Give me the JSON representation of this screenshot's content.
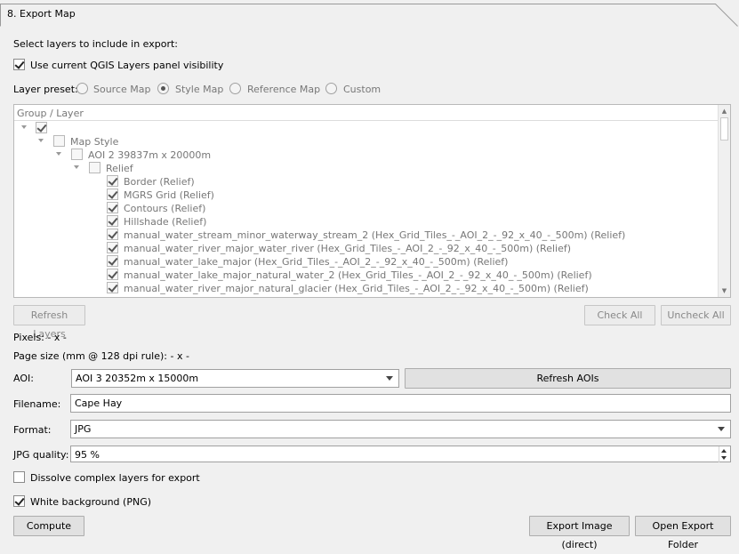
{
  "section": {
    "title": "8. Export Map"
  },
  "select_layers_label": "Select layers to include in export:",
  "use_visibility": {
    "label": "Use current QGIS Layers panel visibility",
    "checked": true
  },
  "layer_preset": {
    "label": "Layer preset:",
    "options": [
      {
        "label": "Source Map",
        "selected": false
      },
      {
        "label": "Style Map",
        "selected": true
      },
      {
        "label": "Reference Map",
        "selected": false
      },
      {
        "label": "Custom",
        "selected": false
      }
    ]
  },
  "tree": {
    "header": "Group / Layer",
    "group": "Map Style",
    "aoi": "AOI 2 39837m x 20000m",
    "subgroup": "Relief",
    "layers": [
      "Border (Relief)",
      "MGRS Grid (Relief)",
      "Contours (Relief)",
      "Hillshade (Relief)",
      "manual_water_stream_minor_waterway_stream_2 (Hex_Grid_Tiles_-_AOI_2_-_92_x_40_-_500m) (Relief)",
      "manual_water_river_major_water_river (Hex_Grid_Tiles_-_AOI_2_-_92_x_40_-_500m) (Relief)",
      "manual_water_lake_major (Hex_Grid_Tiles_-_AOI_2_-_92_x_40_-_500m) (Relief)",
      "manual_water_lake_major_natural_water_2 (Hex_Grid_Tiles_-_AOI_2_-_92_x_40_-_500m) (Relief)",
      "manual_water_river_major_natural_glacier (Hex_Grid_Tiles_-_AOI_2_-_92_x_40_-_500m) (Relief)"
    ]
  },
  "buttons": {
    "refresh_layers": "Refresh Layers",
    "check_all": "Check All",
    "uncheck_all": "Uncheck All",
    "refresh_aois": "Refresh AOIs",
    "compute": "Compute",
    "export_image": "Export Image (direct)",
    "open_folder": "Open Export Folder"
  },
  "pixels": "Pixels:  - x -",
  "page_size": "Page size (mm @ 128 dpi rule): - x -",
  "aoi": {
    "label": "AOI:",
    "value": "AOI 3 20352m x 15000m"
  },
  "filename": {
    "label": "Filename:",
    "value": "Cape Hay"
  },
  "format": {
    "label": "Format:",
    "value": "JPG"
  },
  "jpg_quality": {
    "label": "JPG quality:",
    "value": "95 %"
  },
  "dissolve": {
    "label": "Dissolve complex layers for export",
    "checked": false
  },
  "white_bg": {
    "label": "White background (PNG)",
    "checked": true
  }
}
